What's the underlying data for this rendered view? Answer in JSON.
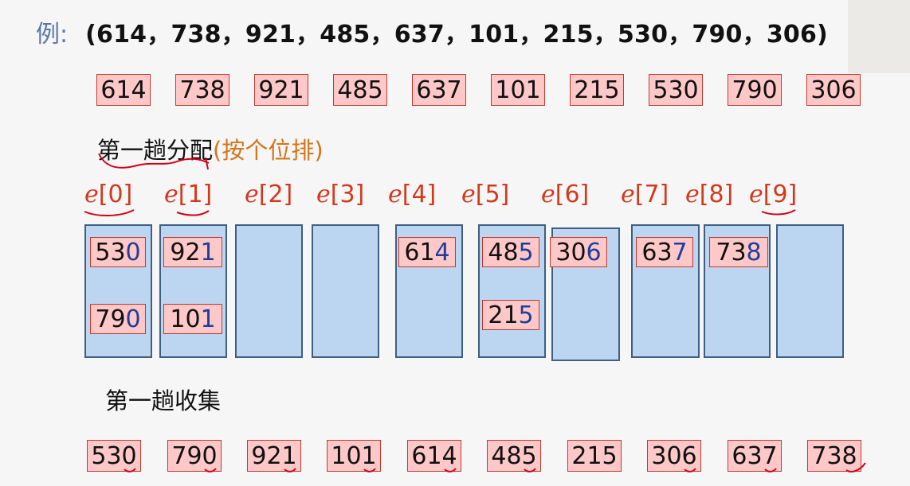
{
  "example": {
    "label": "例:",
    "sequence": "(614，738，921，485，637，101，215，530，790，306)"
  },
  "input_keys": [
    "614",
    "738",
    "921",
    "485",
    "637",
    "101",
    "215",
    "530",
    "790",
    "306"
  ],
  "distribute": {
    "title": "第一趟分配",
    "note": "(按个位排)"
  },
  "buckets": [
    {
      "var": "e",
      "index": "[0]",
      "items": [
        "530",
        "790"
      ]
    },
    {
      "var": "e",
      "index": "[1]",
      "items": [
        "921",
        "101"
      ]
    },
    {
      "var": "e",
      "index": "[2]",
      "items": []
    },
    {
      "var": "e",
      "index": "[3]",
      "items": []
    },
    {
      "var": "e",
      "index": "[4]",
      "items": [
        "614"
      ]
    },
    {
      "var": "e",
      "index": "[5]",
      "items": [
        "485",
        "215"
      ]
    },
    {
      "var": "e",
      "index": "[6]",
      "items": [
        "306"
      ]
    },
    {
      "var": "e",
      "index": "[7]",
      "items": [
        "637"
      ]
    },
    {
      "var": "e",
      "index": "[8]",
      "items": [
        "738"
      ]
    },
    {
      "var": "e",
      "index": "[9]",
      "items": []
    }
  ],
  "collect": {
    "title": "第一趟收集"
  },
  "collected_keys": [
    "530",
    "790",
    "921",
    "101",
    "614",
    "485",
    "215",
    "306",
    "637",
    "738"
  ],
  "colors": {
    "key_box_fill": "#ffc8c8",
    "key_box_border": "#c0392b",
    "bucket_fill": "#bcd6f2",
    "bucket_border": "#3f5f82",
    "bucket_label": "#d23a1e",
    "note_text": "#d4751b",
    "last_digit": "#1f3d9a",
    "annotation_ink": "#d0021b"
  }
}
